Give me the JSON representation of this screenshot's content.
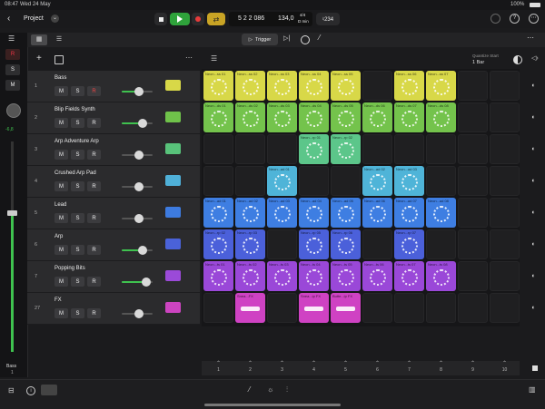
{
  "status": {
    "time": "08:47",
    "date": "Wed 24 May",
    "battery": "100%"
  },
  "header": {
    "project_label": "Project"
  },
  "transport": {
    "position": "5 2 2 086",
    "tempo": "134,0",
    "signature": "4/4",
    "key": "D min",
    "tuner": "♮234"
  },
  "toolbar": {
    "trigger_label": "Trigger",
    "quantize_label": "Quantize Start",
    "quantize_value": "1 Bar"
  },
  "master": {
    "label": "Bass",
    "sub": "1",
    "level": "-6,8"
  },
  "tracks": [
    {
      "num": "1",
      "name": "Bass",
      "color": "#d8d848"
    },
    {
      "num": "2",
      "name": "Blip Fields Synth",
      "color": "#6fc24a"
    },
    {
      "num": "3",
      "name": "Arp Adventure Arp",
      "color": "#58c27a"
    },
    {
      "num": "4",
      "name": "Crushed Arp Pad",
      "color": "#4fb0d8"
    },
    {
      "num": "5",
      "name": "Lead",
      "color": "#3d7be0"
    },
    {
      "num": "6",
      "name": "Arp",
      "color": "#4a62d8"
    },
    {
      "num": "7",
      "name": "Popping Bits",
      "color": "#9b4ad8"
    },
    {
      "num": "27",
      "name": "FX",
      "color": "#cc44c0"
    }
  ],
  "clips": [
    {
      "r": 0,
      "c": 0,
      "label": "Neon...ss 01",
      "color": "#d8d848"
    },
    {
      "r": 0,
      "c": 1,
      "label": "Neon...ss 02",
      "color": "#d8d848"
    },
    {
      "r": 0,
      "c": 2,
      "label": "Neon...ss 03",
      "color": "#d8d848"
    },
    {
      "r": 0,
      "c": 3,
      "label": "Neon...ss 04",
      "color": "#d8d848"
    },
    {
      "r": 0,
      "c": 4,
      "label": "Neon...ss 05",
      "color": "#d8d848"
    },
    {
      "r": 0,
      "c": 6,
      "label": "Neon...ss 06",
      "color": "#d8d848"
    },
    {
      "r": 0,
      "c": 7,
      "label": "Neon...ss 07",
      "color": "#d8d848"
    },
    {
      "r": 1,
      "c": 0,
      "label": "Neon...ds 01",
      "color": "#74c34c"
    },
    {
      "r": 1,
      "c": 1,
      "label": "Neon...ds 02",
      "color": "#74c34c"
    },
    {
      "r": 1,
      "c": 2,
      "label": "Neon...ds 03",
      "color": "#74c34c"
    },
    {
      "r": 1,
      "c": 3,
      "label": "Neon...ds 04",
      "color": "#74c34c"
    },
    {
      "r": 1,
      "c": 4,
      "label": "Neon...ds 05",
      "color": "#74c34c"
    },
    {
      "r": 1,
      "c": 5,
      "label": "Neon...ds 06",
      "color": "#74c34c"
    },
    {
      "r": 1,
      "c": 6,
      "label": "Neon...ds 07",
      "color": "#74c34c"
    },
    {
      "r": 1,
      "c": 7,
      "label": "Neon...ds 08",
      "color": "#74c34c"
    },
    {
      "r": 2,
      "c": 3,
      "label": "Neon...rp 01",
      "color": "#5cc68a"
    },
    {
      "r": 2,
      "c": 4,
      "label": "Neon...rp 02",
      "color": "#5cc68a"
    },
    {
      "r": 3,
      "c": 2,
      "label": "Neon...ad 01",
      "color": "#4fb4d8"
    },
    {
      "r": 3,
      "c": 5,
      "label": "Neon...ad 02",
      "color": "#4fb4d8"
    },
    {
      "r": 3,
      "c": 6,
      "label": "Neon...ad 03",
      "color": "#4fb4d8"
    },
    {
      "r": 4,
      "c": 0,
      "label": "Neon...ad 01",
      "color": "#3e7ee2"
    },
    {
      "r": 4,
      "c": 1,
      "label": "Neon...ad 02",
      "color": "#3e7ee2"
    },
    {
      "r": 4,
      "c": 2,
      "label": "Neon...ad 03",
      "color": "#3e7ee2"
    },
    {
      "r": 4,
      "c": 3,
      "label": "Neon...ad 04",
      "color": "#3e7ee2"
    },
    {
      "r": 4,
      "c": 4,
      "label": "Neon...ad 05",
      "color": "#3e7ee2"
    },
    {
      "r": 4,
      "c": 5,
      "label": "Neon...ad 06",
      "color": "#3e7ee2"
    },
    {
      "r": 4,
      "c": 6,
      "label": "Neon...ad 07",
      "color": "#3e7ee2"
    },
    {
      "r": 4,
      "c": 7,
      "label": "Neon...ad 08",
      "color": "#3e7ee2"
    },
    {
      "r": 5,
      "c": 0,
      "label": "Neon...rp 02",
      "color": "#4b60da"
    },
    {
      "r": 5,
      "c": 1,
      "label": "Neon...rp 03",
      "color": "#4b60da"
    },
    {
      "r": 5,
      "c": 3,
      "label": "Neon...rp 05",
      "color": "#4b60da"
    },
    {
      "r": 5,
      "c": 4,
      "label": "Neon...rp 06",
      "color": "#4b60da"
    },
    {
      "r": 5,
      "c": 6,
      "label": "Neon...rp 07",
      "color": "#4b60da"
    },
    {
      "r": 6,
      "c": 0,
      "label": "Neon...ts 01",
      "color": "#9a48d8"
    },
    {
      "r": 6,
      "c": 1,
      "label": "Neon...ts 02",
      "color": "#9a48d8"
    },
    {
      "r": 6,
      "c": 2,
      "label": "Neon...ts 03",
      "color": "#9a48d8"
    },
    {
      "r": 6,
      "c": 3,
      "label": "Neon...ts 04",
      "color": "#9a48d8"
    },
    {
      "r": 6,
      "c": 4,
      "label": "Neon...ts 05",
      "color": "#9a48d8"
    },
    {
      "r": 6,
      "c": 5,
      "label": "Neon...ts 06",
      "color": "#9a48d8"
    },
    {
      "r": 6,
      "c": 6,
      "label": "Neon...ts 07",
      "color": "#9a48d8"
    },
    {
      "r": 6,
      "c": 7,
      "label": "Neon...ts 08",
      "color": "#9a48d8"
    },
    {
      "r": 7,
      "c": 1,
      "label": "Snea...FX",
      "color": "#cf42c3",
      "bar": true
    },
    {
      "r": 7,
      "c": 3,
      "label": "Snea...ip FX",
      "color": "#cf42c3",
      "bar": true
    },
    {
      "r": 7,
      "c": 4,
      "label": "Butte...ip FX",
      "color": "#cf42c3",
      "bar": true
    }
  ],
  "scenes": [
    "1",
    "2",
    "3",
    "4",
    "5",
    "6",
    "7",
    "8",
    "9",
    "10"
  ],
  "buttons": {
    "m": "M",
    "s": "S",
    "r": "R"
  }
}
